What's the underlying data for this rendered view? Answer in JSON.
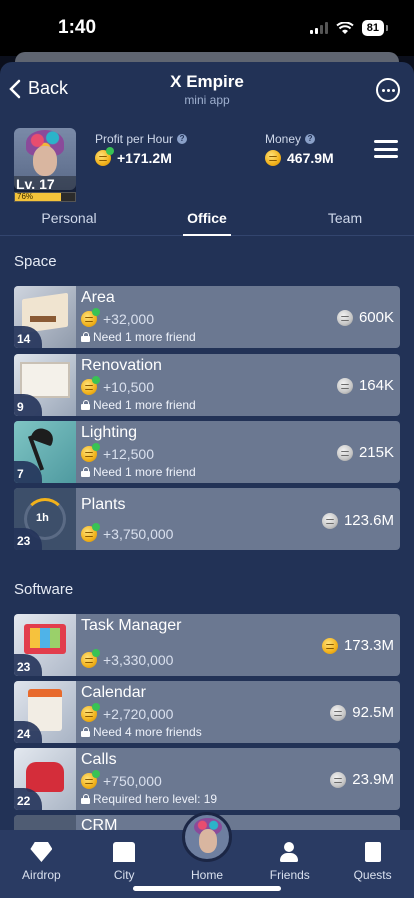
{
  "status_bar": {
    "time": "1:40",
    "battery": "81"
  },
  "header": {
    "back_label": "Back",
    "title": "X Empire",
    "subtitle": "mini app"
  },
  "profile": {
    "level_label": "Lv. 17",
    "level_progress": "76%",
    "profit_label": "Profit per Hour",
    "profit_value": "+171.2M",
    "money_label": "Money",
    "money_value": "467.9M"
  },
  "tabs": [
    {
      "label": "Personal",
      "active": false
    },
    {
      "label": "Office",
      "active": true
    },
    {
      "label": "Team",
      "active": false
    }
  ],
  "sections": {
    "space": "Space",
    "software": "Software"
  },
  "space_items": [
    {
      "name": "Area",
      "level": "14",
      "profit": "+32,000",
      "lock": "Need 1 more friend",
      "price": "600K",
      "coin": "grey",
      "icon": "office-room-icon"
    },
    {
      "name": "Renovation",
      "level": "9",
      "profit": "+10,500",
      "lock": "Need 1 more friend",
      "price": "164K",
      "coin": "grey",
      "icon": "renovation-room-icon"
    },
    {
      "name": "Lighting",
      "level": "7",
      "profit": "+12,500",
      "lock": "Need 1 more friend",
      "price": "215K",
      "coin": "grey",
      "icon": "desk-lamp-icon"
    },
    {
      "name": "Plants",
      "level": "23",
      "profit": "+3,750,000",
      "timer": "1h",
      "price": "123.6M",
      "coin": "grey",
      "icon": "timer-ring-icon"
    }
  ],
  "software_items": [
    {
      "name": "Task Manager",
      "level": "23",
      "profit": "+3,330,000",
      "price": "173.3M",
      "coin": "gold",
      "icon": "task-manager-icon"
    },
    {
      "name": "Calendar",
      "level": "24",
      "profit": "+2,720,000",
      "lock": "Need 4 more friends",
      "price": "92.5M",
      "coin": "grey",
      "icon": "calendar-icon"
    },
    {
      "name": "Calls",
      "level": "22",
      "profit": "+750,000",
      "lock": "Required hero level: 19",
      "price": "23.9M",
      "coin": "grey",
      "icon": "telephone-icon"
    },
    {
      "name": "CRM",
      "icon": "crm-icon"
    }
  ],
  "nav": [
    {
      "label": "Airdrop",
      "icon": "diamond-icon"
    },
    {
      "label": "City",
      "icon": "city-icon"
    },
    {
      "label": "Home",
      "icon": "avatar-icon"
    },
    {
      "label": "Friends",
      "icon": "friends-icon"
    },
    {
      "label": "Quests",
      "icon": "quests-icon"
    }
  ],
  "colors": {
    "background": "#223256",
    "card": "#6b7891",
    "coin_gold": "#f2b21b",
    "coin_boost": "#39c255"
  }
}
